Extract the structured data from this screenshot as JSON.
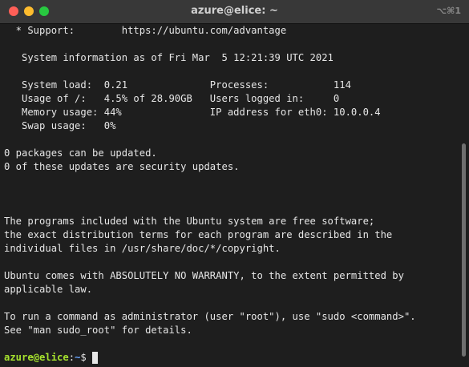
{
  "window": {
    "title": "azure@elice: ~",
    "shortcut": "⌥⌘1"
  },
  "terminal": {
    "lines": [
      "  * Support:        https://ubuntu.com/advantage",
      "",
      "   System information as of Fri Mar  5 12:21:39 UTC 2021",
      "",
      "   System load:  0.21              Processes:           114",
      "   Usage of /:   4.5% of 28.90GB   Users logged in:     0",
      "   Memory usage: 44%               IP address for eth0: 10.0.0.4",
      "   Swap usage:   0%",
      "",
      "0 packages can be updated.",
      "0 of these updates are security updates.",
      "",
      "",
      "",
      "The programs included with the Ubuntu system are free software;",
      "the exact distribution terms for each program are described in the",
      "individual files in /usr/share/doc/*/copyright.",
      "",
      "Ubuntu comes with ABSOLUTELY NO WARRANTY, to the extent permitted by",
      "applicable law.",
      "",
      "To run a command as administrator (user \"root\"), use \"sudo <command>\".",
      "See \"man sudo_root\" for details.",
      ""
    ],
    "prompt_user": "azure@elice",
    "prompt_sep": ":",
    "prompt_path": "~",
    "prompt_symbol": "$"
  }
}
